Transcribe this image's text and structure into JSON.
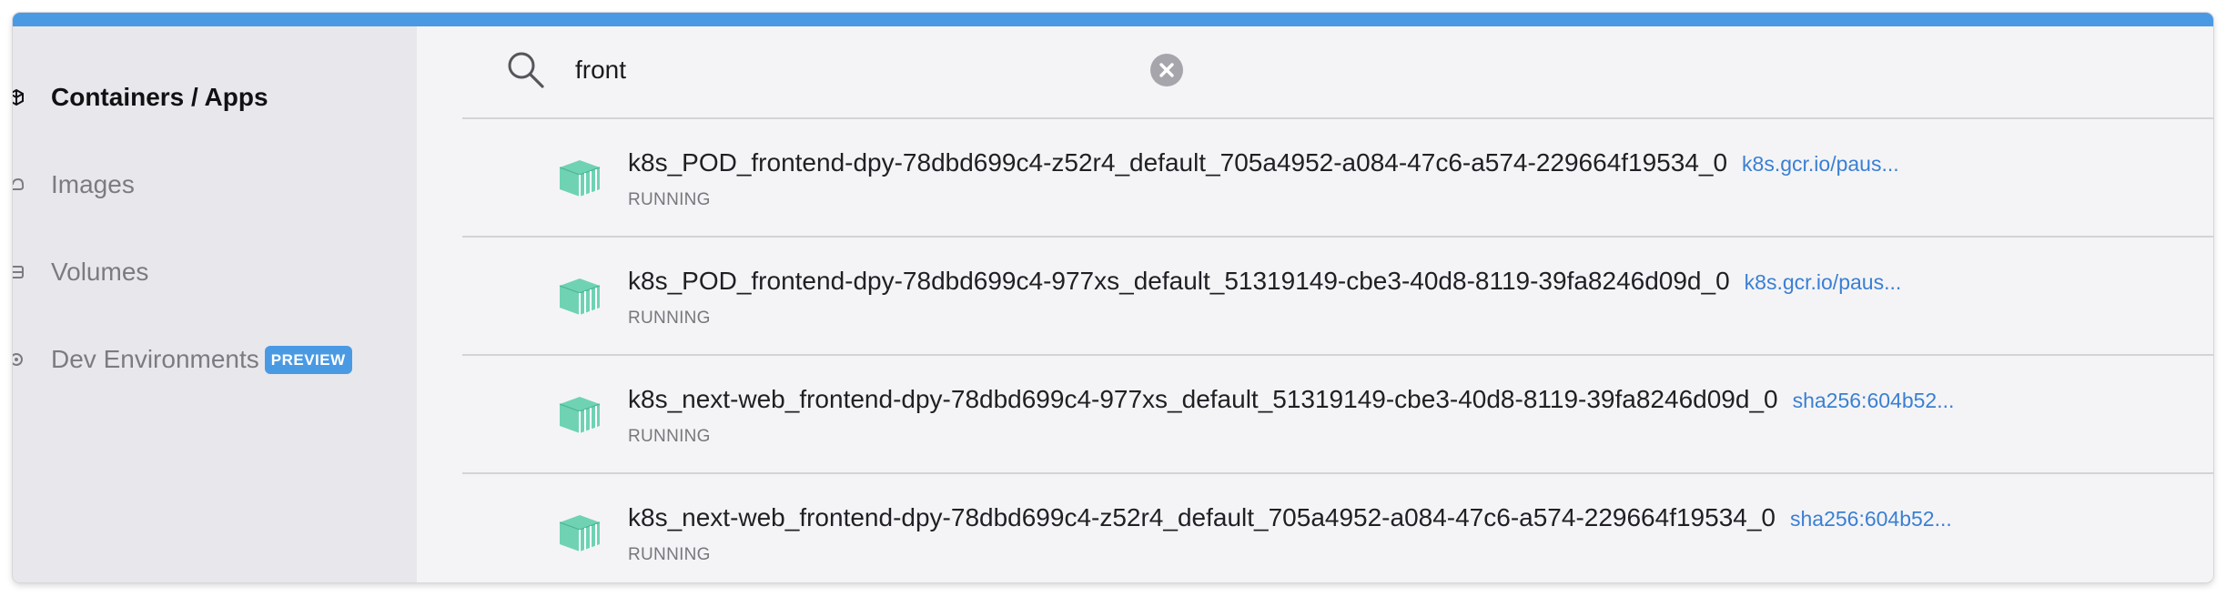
{
  "sidebar": {
    "items": [
      {
        "label": "Containers / Apps",
        "icon": "cube-icon",
        "active": true
      },
      {
        "label": "Images",
        "icon": "cloud-icon",
        "active": false
      },
      {
        "label": "Volumes",
        "icon": "database-icon",
        "active": false
      },
      {
        "label": "Dev Environments",
        "icon": "dev-env-icon",
        "active": false,
        "badge": "PREVIEW"
      }
    ]
  },
  "search": {
    "value": "front",
    "icon": "search-icon",
    "clear_icon": "close-circle-icon"
  },
  "containers": [
    {
      "name": "k8s_POD_frontend-dpy-78dbd699c4-z52r4_default_705a4952-a084-47c6-a574-229664f19534_0",
      "image": "k8s.gcr.io/paus...",
      "status": "RUNNING"
    },
    {
      "name": "k8s_POD_frontend-dpy-78dbd699c4-977xs_default_51319149-cbe3-40d8-8119-39fa8246d09d_0",
      "image": "k8s.gcr.io/paus...",
      "status": "RUNNING"
    },
    {
      "name": "k8s_next-web_frontend-dpy-78dbd699c4-977xs_default_51319149-cbe3-40d8-8119-39fa8246d09d_0",
      "image": "sha256:604b52...",
      "status": "RUNNING"
    },
    {
      "name": "k8s_next-web_frontend-dpy-78dbd699c4-z52r4_default_705a4952-a084-47c6-a574-229664f19534_0",
      "image": "sha256:604b52...",
      "status": "RUNNING"
    }
  ],
  "colors": {
    "accent": "#4a9ae3",
    "container_icon": "#6fd3b3",
    "link": "#3a7fd3"
  }
}
